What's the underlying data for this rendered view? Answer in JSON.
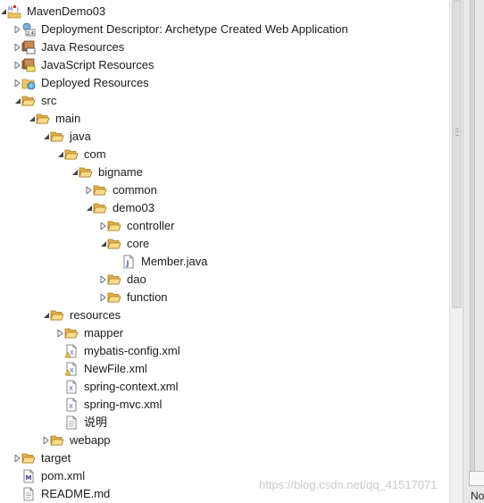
{
  "tree": {
    "items": [
      {
        "label": "MavenDemo03",
        "icon": "maven-project-icon",
        "toggle": "expanded"
      },
      {
        "label": "Deployment Descriptor: Archetype Created Web Application",
        "icon": "deployment-descriptor-icon",
        "toggle": "collapsed"
      },
      {
        "label": "Java Resources",
        "icon": "java-resources-icon",
        "toggle": "collapsed"
      },
      {
        "label": "JavaScript Resources",
        "icon": "javascript-resources-icon",
        "toggle": "collapsed"
      },
      {
        "label": "Deployed Resources",
        "icon": "deployed-resources-icon",
        "toggle": "collapsed"
      },
      {
        "label": "src",
        "icon": "folder-icon",
        "toggle": "expanded"
      },
      {
        "label": "main",
        "icon": "folder-icon",
        "toggle": "expanded"
      },
      {
        "label": "java",
        "icon": "folder-icon",
        "toggle": "expanded"
      },
      {
        "label": "com",
        "icon": "folder-icon",
        "toggle": "expanded"
      },
      {
        "label": "bigname",
        "icon": "folder-icon",
        "toggle": "expanded"
      },
      {
        "label": "common",
        "icon": "folder-icon",
        "toggle": "collapsed"
      },
      {
        "label": "demo03",
        "icon": "folder-icon",
        "toggle": "expanded"
      },
      {
        "label": "controller",
        "icon": "folder-icon",
        "toggle": "collapsed"
      },
      {
        "label": "core",
        "icon": "folder-icon",
        "toggle": "expanded"
      },
      {
        "label": "Member.java",
        "icon": "java-file-icon",
        "toggle": "none"
      },
      {
        "label": "dao",
        "icon": "folder-icon",
        "toggle": "collapsed"
      },
      {
        "label": "function",
        "icon": "folder-icon",
        "toggle": "collapsed"
      },
      {
        "label": "resources",
        "icon": "folder-icon",
        "toggle": "expanded"
      },
      {
        "label": "mapper",
        "icon": "folder-icon",
        "toggle": "collapsed"
      },
      {
        "label": "mybatis-config.xml",
        "icon": "xml-file-warning-icon",
        "toggle": "none"
      },
      {
        "label": "NewFile.xml",
        "icon": "xml-file-warning-icon",
        "toggle": "none"
      },
      {
        "label": "spring-context.xml",
        "icon": "xml-file-icon",
        "toggle": "none"
      },
      {
        "label": "spring-mvc.xml",
        "icon": "xml-file-icon",
        "toggle": "none"
      },
      {
        "label": "说明",
        "icon": "text-file-icon",
        "toggle": "none"
      },
      {
        "label": "webapp",
        "icon": "folder-icon",
        "toggle": "collapsed"
      },
      {
        "label": "target",
        "icon": "folder-icon",
        "toggle": "collapsed"
      },
      {
        "label": "pom.xml",
        "icon": "maven-pom-icon",
        "toggle": "none"
      },
      {
        "label": "README.md",
        "icon": "text-file-icon",
        "toggle": "none"
      }
    ]
  },
  "right_pane": {
    "text": "No"
  },
  "watermark": "https://blog.csdn.net/qq_41517071"
}
